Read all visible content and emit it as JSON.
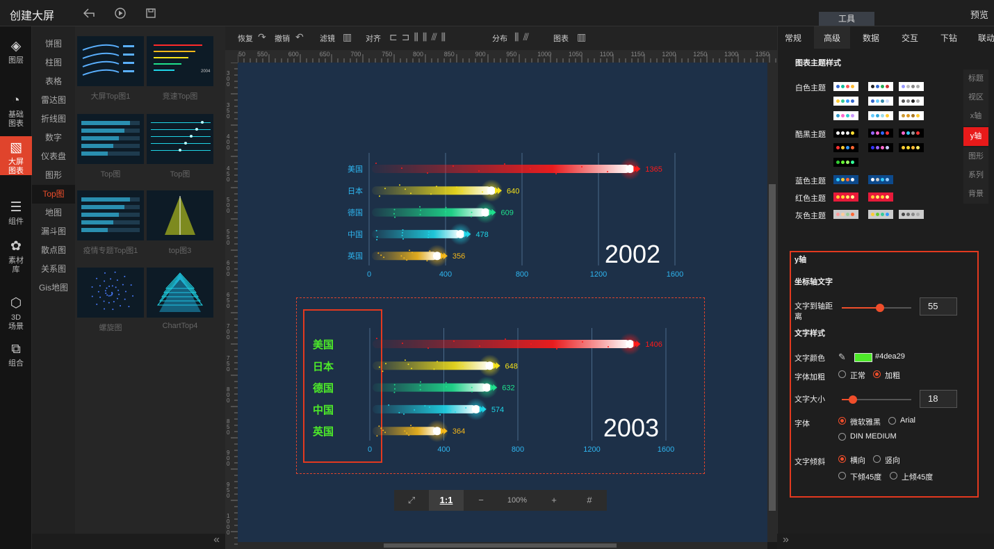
{
  "app": {
    "title": "创建大屏",
    "preview": "预览",
    "tool_tab": "工具"
  },
  "leftnav": [
    {
      "label": "图层",
      "icon": "layers-icon"
    },
    {
      "label": "基础\n图表",
      "icon": "pie-chart-icon"
    },
    {
      "label": "大屏\n图表",
      "icon": "monitor-chart-icon",
      "active": true
    },
    {
      "label": "组件",
      "icon": "sliders-icon"
    },
    {
      "label": "素材\n库",
      "icon": "material-icon"
    },
    {
      "label": "3D\n场景",
      "icon": "cube-icon"
    },
    {
      "label": "组合",
      "icon": "group-icon"
    }
  ],
  "categories": [
    "饼图",
    "柱图",
    "表格",
    "雷达图",
    "折线图",
    "数字",
    "仪表盘",
    "图形",
    "Top图",
    "地图",
    "漏斗图",
    "散点图",
    "关系图",
    "Gis地图"
  ],
  "active_category": "Top图",
  "thumbs": [
    "大屏Top图1",
    "竞速Top图",
    "Top图",
    "Top图",
    "疫情专题Top图1",
    "top图3",
    "螺旋图",
    "ChartTop4"
  ],
  "thumb2_year": "2004",
  "toolbar": {
    "redo": "恢复",
    "undo": "撤销",
    "filter": "滤镜",
    "align": "对齐",
    "distribute": "分布",
    "chart": "图表"
  },
  "ruler_h": [
    "50",
    "550",
    "600",
    "650",
    "700",
    "750",
    "800",
    "850",
    "900",
    "950",
    "1000",
    "1050",
    "1100",
    "1150",
    "1200",
    "1250",
    "1300",
    "1350",
    "140"
  ],
  "ruler_v": [
    "300",
    "350",
    "400",
    "450",
    "500",
    "550",
    "600",
    "650",
    "700",
    "750",
    "800",
    "850",
    "900",
    "950",
    "1000"
  ],
  "zoom": {
    "ratio": "1:1",
    "value": "100%",
    "minus": "−",
    "plus": "+"
  },
  "rightpanel": {
    "tabs": [
      "常规",
      "高级",
      "数据",
      "交互",
      "下钻",
      "联动"
    ],
    "active_tab": "高级",
    "theme_title": "图表主题样式",
    "themes": [
      "白色主题",
      "酷黑主题",
      "蓝色主题",
      "红色主题",
      "灰色主题"
    ],
    "side_tabs": [
      "标题",
      "视区",
      "x轴",
      "y轴",
      "图形",
      "系列",
      "背景"
    ],
    "active_side_tab": "y轴",
    "yaxis": {
      "title": "y轴",
      "axis_text": "坐标轴文字",
      "distance_label": "文字到轴距离",
      "distance": "55",
      "text_style": "文字样式",
      "color_label": "文字颜色",
      "color": "#4dea29",
      "bold_label": "字体加粗",
      "bold_opts": [
        "正常",
        "加粗"
      ],
      "size_label": "文字大小",
      "size": "18",
      "font_label": "字体",
      "font_opts": [
        "微软雅黑",
        "Arial",
        "DIN MEDIUM"
      ],
      "tilt_label": "文字倾斜",
      "tilt_opts": [
        "横向",
        "竖向",
        "下倾45度",
        "上倾45度"
      ]
    }
  },
  "chart_data": [
    {
      "type": "bar",
      "title": "2002",
      "categories": [
        "美国",
        "日本",
        "德国",
        "中国",
        "英国"
      ],
      "values": [
        1365,
        640,
        609,
        478,
        356
      ],
      "xticks": [
        "0",
        "400",
        "800",
        "1200",
        "1600"
      ],
      "xlim": [
        0,
        1600
      ],
      "colors": [
        "#ff1a1a",
        "#f5e21a",
        "#1fe08d",
        "#1fd6e8",
        "#f5b81a"
      ]
    },
    {
      "type": "bar",
      "title": "2003",
      "categories": [
        "美国",
        "日本",
        "德国",
        "中国",
        "英国"
      ],
      "values": [
        1406,
        648,
        632,
        574,
        364
      ],
      "xticks": [
        "0",
        "400",
        "800",
        "1200",
        "1600"
      ],
      "xlim": [
        0,
        1600
      ],
      "colors": [
        "#ff1a1a",
        "#f5e21a",
        "#1fe08d",
        "#1fd6e8",
        "#f5b81a"
      ],
      "label_color": "#4dea29"
    }
  ]
}
